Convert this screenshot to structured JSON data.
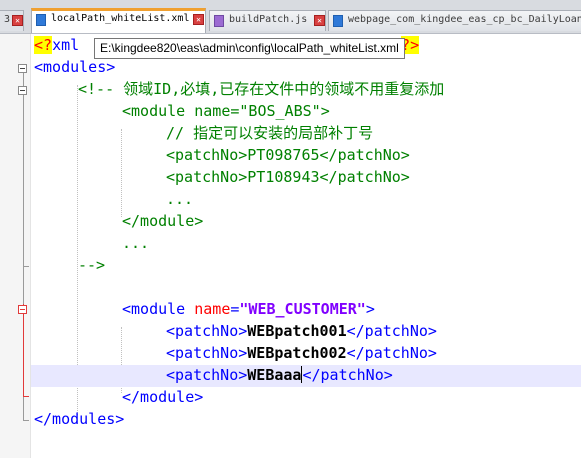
{
  "tabs": [
    {
      "label": "localPath_whiteList.xml",
      "active": true
    },
    {
      "label": "buildPatch.js",
      "active": false
    },
    {
      "label": "webpage_com_kingdee_eas_cp_bc_DailyLoan",
      "active": false
    }
  ],
  "left_tab_fragment": "3",
  "tooltip": "E:\\kingdee820\\eas\\admin\\config\\localPath_whiteList.xml",
  "editor": {
    "lines": {
      "l1_pi_open": "<?",
      "l1_xml": "xml",
      "l1_pi_close": "?>",
      "l2": "<modules>",
      "l3": "<!-- 领域ID,必填,已存在文件中的领域不用重复添加",
      "l4_tag": "<module ",
      "l4_attr": "name=",
      "l4_val": "\"BOS_ABS\"",
      "l4_end": ">",
      "l5": "// 指定可以安装的局部补丁号",
      "l6": "<patchNo>PT098765</patchNo>",
      "l7": "<patchNo>PT108943</patchNo>",
      "l8": "...",
      "l9": "</module>",
      "l10": "...",
      "l11": "-->",
      "l13_tag": "<module ",
      "l13_attr": "name",
      "l13_eq": "=",
      "l13_val": "\"WEB_CUSTOMER\"",
      "l13_end": ">",
      "l14_open": "<patchNo>",
      "l14_text": "WEBpatch001",
      "l14_close": "</patchNo>",
      "l15_open": "<patchNo>",
      "l15_text": "WEBpatch002",
      "l15_close": "</patchNo>",
      "l16_open": "<patchNo>",
      "l16_text": "WEBaaa",
      "l16_close": "</patchNo>",
      "l17": "</module>",
      "l18": "</modules>"
    },
    "colors": {
      "tag": "#0000ff",
      "attribute": "#ff0000",
      "attribute_value": "#8000ff",
      "comment": "#008000",
      "text": "#000000",
      "pi_highlight": "#ffff00",
      "current_line": "#e8e8ff"
    }
  }
}
